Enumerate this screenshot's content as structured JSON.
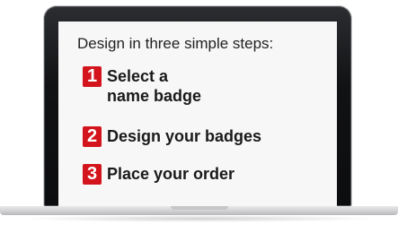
{
  "headline": "Design in three simple steps:",
  "accent_color": "#d4141c",
  "steps": [
    {
      "number": "1",
      "label_line1": "Select a",
      "label_line2": "name badge"
    },
    {
      "number": "2",
      "label": "Design your badges"
    },
    {
      "number": "3",
      "label": "Place your order"
    }
  ]
}
